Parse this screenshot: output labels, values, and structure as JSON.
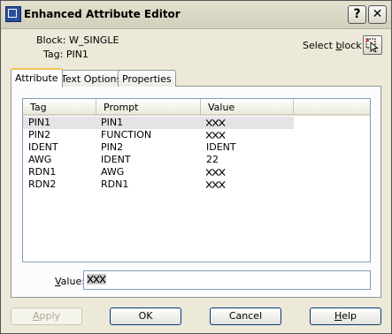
{
  "window": {
    "title": "Enhanced Attribute Editor",
    "help_glyph": "?",
    "close_glyph": "✕"
  },
  "info": {
    "block_label": "Block:",
    "block_value": "W_SINGLE",
    "tag_label": "Tag:",
    "tag_value": "PIN1"
  },
  "select_block": {
    "label_pre": "Select ",
    "label_key": "b",
    "label_post": "lock"
  },
  "tabs": [
    {
      "label": "Attribute",
      "active": true
    },
    {
      "label": "Text Options",
      "active": false
    },
    {
      "label": "Properties",
      "active": false
    }
  ],
  "attributes": {
    "columns": [
      "Tag",
      "Prompt",
      "Value"
    ],
    "rows": [
      {
        "tag": "PIN1",
        "prompt": "PIN1",
        "value": "XXX",
        "selected": true
      },
      {
        "tag": "PIN2",
        "prompt": "FUNCTION",
        "value": "XXX"
      },
      {
        "tag": "IDENT",
        "prompt": "PIN2",
        "value": "IDENT"
      },
      {
        "tag": "AWG",
        "prompt": "IDENT",
        "value": "22"
      },
      {
        "tag": "RDN1",
        "prompt": "AWG",
        "value": "XXX"
      },
      {
        "tag": "RDN2",
        "prompt": "RDN1",
        "value": "XXX"
      }
    ]
  },
  "value_field": {
    "label_key": "V",
    "label_rest": "alue:",
    "current_value": "XXX"
  },
  "buttons": {
    "apply": {
      "key": "A",
      "rest": "pply",
      "enabled": false
    },
    "ok": {
      "label": "OK"
    },
    "cancel": {
      "label": "Cancel"
    },
    "help": {
      "key": "H",
      "rest": "elp"
    }
  },
  "colors": {
    "title_bar": "#d8d5c2",
    "tab_highlight": "#f1c14b",
    "selected_row": "#e4e4e6"
  }
}
